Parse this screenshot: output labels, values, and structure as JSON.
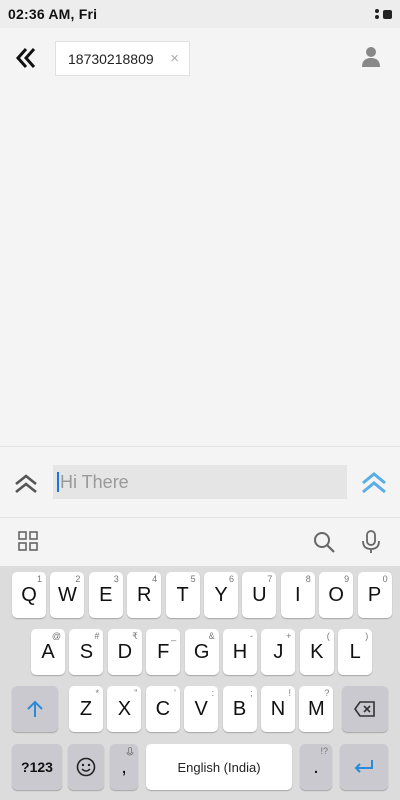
{
  "status_bar": {
    "time": "02:36 AM, Fri"
  },
  "header": {
    "back_icon": "double-chevron-left-icon",
    "recipient": "18730218809",
    "chip_close": "×",
    "contact_icon": "person-icon"
  },
  "compose": {
    "expand_icon": "double-chevron-up-icon",
    "message_text": "Hi There",
    "send_icon": "double-chevron-up-icon",
    "accent_color": "#5aaee8"
  },
  "keyboard_toolbar": {
    "apps_icon": "grid-icon",
    "search_icon": "search-icon",
    "mic_icon": "microphone-icon"
  },
  "keyboard": {
    "row1": [
      {
        "label": "Q",
        "hint": "1"
      },
      {
        "label": "W",
        "hint": "2"
      },
      {
        "label": "E",
        "hint": "3"
      },
      {
        "label": "R",
        "hint": "4"
      },
      {
        "label": "T",
        "hint": "5"
      },
      {
        "label": "Y",
        "hint": "6"
      },
      {
        "label": "U",
        "hint": "7"
      },
      {
        "label": "I",
        "hint": "8"
      },
      {
        "label": "O",
        "hint": "9"
      },
      {
        "label": "P",
        "hint": "0"
      }
    ],
    "row2": [
      {
        "label": "A",
        "hint": "@"
      },
      {
        "label": "S",
        "hint": "#"
      },
      {
        "label": "D",
        "hint": "₹"
      },
      {
        "label": "F",
        "hint": "_"
      },
      {
        "label": "G",
        "hint": "&"
      },
      {
        "label": "H",
        "hint": "-"
      },
      {
        "label": "J",
        "hint": "+"
      },
      {
        "label": "K",
        "hint": "("
      },
      {
        "label": "L",
        "hint": ")"
      }
    ],
    "row3": [
      {
        "label": "Z",
        "hint": "*"
      },
      {
        "label": "X",
        "hint": "\""
      },
      {
        "label": "C",
        "hint": "'"
      },
      {
        "label": "V",
        "hint": ":"
      },
      {
        "label": "B",
        "hint": ";"
      },
      {
        "label": "N",
        "hint": "!"
      },
      {
        "label": "M",
        "hint": "?"
      }
    ],
    "symbols_label": "?123",
    "comma_label": ",",
    "space_label": "English (India)",
    "period_label": ".",
    "period_hint": "!?",
    "shift_icon": "shift-arrow-icon",
    "backspace_icon": "backspace-icon",
    "emoji_icon": "emoji-icon",
    "enter_icon": "enter-return-icon"
  }
}
